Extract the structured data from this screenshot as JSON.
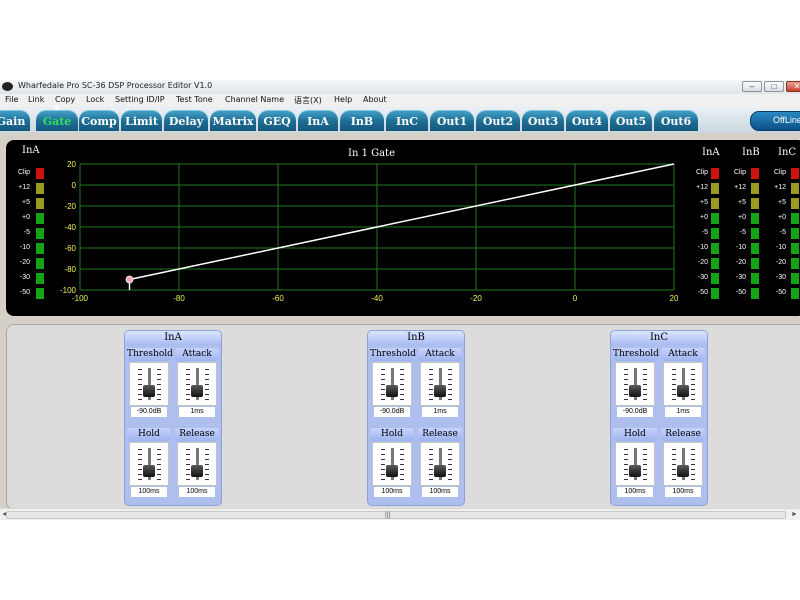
{
  "window": {
    "title": "Wharfedale Pro SC-36 DSP Processor Editor V1.0"
  },
  "window_controls": {
    "minimize": "–",
    "maximize": "□",
    "close": "✕"
  },
  "menu": [
    "File",
    "Link",
    "Copy",
    "Lock",
    "Setting ID/IP",
    "Test Tone",
    "Channel Name",
    "语言(X)",
    "Help",
    "About"
  ],
  "tabs": [
    "Gain",
    "Gate",
    "Comp",
    "Limit",
    "Delay",
    "Matrix",
    "GEQ",
    "InA",
    "InB",
    "InC",
    "Out1",
    "Out2",
    "Out3",
    "Out4",
    "Out5",
    "Out6"
  ],
  "active_tab": "Gate",
  "status_button": "OffLine",
  "graph": {
    "title": "In 1  Gate",
    "x_ticks": [
      "-100",
      "-80",
      "-60",
      "-40",
      "-20",
      "0",
      "20"
    ],
    "y_ticks": [
      "20",
      "0",
      "-20",
      "-40",
      "-60",
      "-80",
      "-100"
    ],
    "colors": {
      "grid": "#1e7a1e",
      "line": "#ffffff",
      "handle": "#f2a7b3",
      "axis_text": "#f2f25a"
    }
  },
  "chart_data": {
    "type": "line",
    "title": "In 1  Gate",
    "x": [
      -90,
      20
    ],
    "y": [
      -90,
      20
    ],
    "xlim": [
      -100,
      20
    ],
    "ylim": [
      -100,
      20
    ],
    "x_ticks": [
      -100,
      -80,
      -60,
      -40,
      -20,
      0,
      20
    ],
    "y_ticks": [
      20,
      0,
      -20,
      -40,
      -60,
      -80,
      -100
    ],
    "grid": true
  },
  "meters": {
    "labels": [
      "Clip",
      "+12",
      "+5",
      "+0",
      "-5",
      "-10",
      "-20",
      "-30",
      "-50"
    ],
    "left": {
      "name": "InA"
    },
    "right": [
      {
        "name": "InA"
      },
      {
        "name": "InB"
      },
      {
        "name": "InC"
      }
    ],
    "colors": {
      "clip": "#cc1111",
      "high": "#9a9a22",
      "normal": "#16a316"
    }
  },
  "channels": [
    {
      "name": "InA",
      "threshold": {
        "label": "Threshold",
        "value": "-90.0dB"
      },
      "attack": {
        "label": "Attack",
        "value": "1ms"
      },
      "hold": {
        "label": "Hold",
        "value": "100ms"
      },
      "release": {
        "label": "Release",
        "value": "100ms"
      }
    },
    {
      "name": "InB",
      "threshold": {
        "label": "Threshold",
        "value": "-90.0dB"
      },
      "attack": {
        "label": "Attack",
        "value": "1ms"
      },
      "hold": {
        "label": "Hold",
        "value": "100ms"
      },
      "release": {
        "label": "Release",
        "value": "100ms"
      }
    },
    {
      "name": "InC",
      "threshold": {
        "label": "Threshold",
        "value": "-90.0dB"
      },
      "attack": {
        "label": "Attack",
        "value": "1ms"
      },
      "hold": {
        "label": "Hold",
        "value": "100ms"
      },
      "release": {
        "label": "Release",
        "value": "100ms"
      }
    }
  ],
  "scrollbar": {
    "left_arrow": "◄",
    "right_arrow": "►",
    "grip": "|||"
  }
}
